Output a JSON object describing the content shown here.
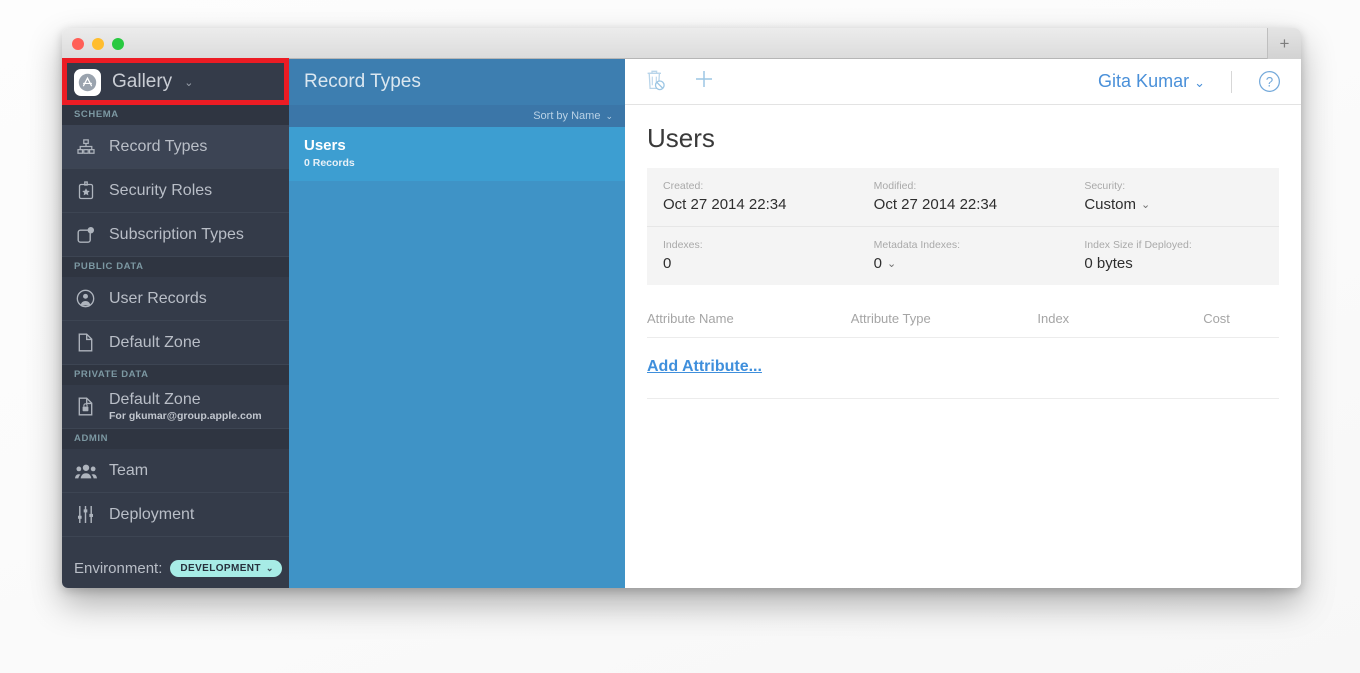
{
  "window": {
    "traffic_lights": [
      "close",
      "minimize",
      "maximize"
    ],
    "zoom_button_label": "+"
  },
  "sidebar": {
    "app": {
      "name": "Gallery",
      "caret": "⌄",
      "icon": "app-store-icon"
    },
    "groups": [
      {
        "header": "SCHEMA",
        "items": [
          {
            "label": "Record Types",
            "icon": "hierarchy-icon",
            "active": true
          },
          {
            "label": "Security Roles",
            "icon": "badge-star-icon",
            "active": false
          },
          {
            "label": "Subscription Types",
            "icon": "subscription-icon",
            "active": false
          }
        ]
      },
      {
        "header": "PUBLIC DATA",
        "items": [
          {
            "label": "User Records",
            "icon": "person-circle-icon",
            "active": false
          },
          {
            "label": "Default Zone",
            "icon": "document-icon",
            "active": false
          }
        ]
      },
      {
        "header": "PRIVATE DATA",
        "items": [
          {
            "label": "Default Zone",
            "sublabel": "For gkumar@group.apple.com",
            "icon": "document-lock-icon",
            "active": false
          }
        ]
      },
      {
        "header": "ADMIN",
        "items": [
          {
            "label": "Team",
            "icon": "people-icon",
            "active": false
          },
          {
            "label": "Deployment",
            "icon": "sliders-icon",
            "active": false
          }
        ]
      }
    ],
    "environment": {
      "label": "Environment:",
      "value": "DEVELOPMENT",
      "caret": "⌄"
    }
  },
  "list_panel": {
    "title": "Record Types",
    "sort": {
      "label": "Sort by Name",
      "caret": "⌄"
    },
    "items": [
      {
        "name": "Users",
        "subtitle": "0 Records",
        "selected": true
      }
    ]
  },
  "detail": {
    "toolbar": {
      "delete_icon": "trash-disabled-icon",
      "add_icon": "plus-icon",
      "user": "Gita Kumar",
      "user_caret": "⌄",
      "help_icon": "question-circle-icon"
    },
    "title": "Users",
    "info": [
      {
        "key": "Created:",
        "value": "Oct 27 2014 22:34",
        "caret": ""
      },
      {
        "key": "Modified:",
        "value": "Oct 27 2014 22:34",
        "caret": ""
      },
      {
        "key": "Security:",
        "value": "Custom",
        "caret": "⌄"
      },
      {
        "key": "Indexes:",
        "value": "0",
        "caret": ""
      },
      {
        "key": "Metadata Indexes:",
        "value": "0",
        "caret": "⌄"
      },
      {
        "key": "Index Size if Deployed:",
        "value": "0 bytes",
        "caret": ""
      }
    ],
    "table": {
      "columns": [
        "Attribute Name",
        "Attribute Type",
        "Index",
        "Cost"
      ],
      "rows": [],
      "add_link": "Add Attribute..."
    }
  },
  "colors": {
    "sidebar_bg": "#343b49",
    "sidebar_group_bg": "#2f3541",
    "list_header_blue": "#3d7eb0",
    "list_bg_blue": "#3f93c6",
    "selected_row_blue": "#3d9ed1",
    "accent_link": "#3f8fdc",
    "env_badge": "#a7ece6",
    "highlight_red": "#ec1c24"
  }
}
